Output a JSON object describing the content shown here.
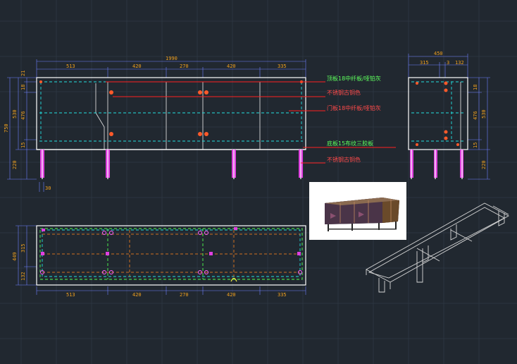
{
  "front_view": {
    "overall_width": "1990",
    "segments": [
      "513",
      "420",
      "270",
      "420",
      "335"
    ],
    "left_dims_outer": "750",
    "left_dims_mid": "530",
    "left_dims": [
      "21",
      "18",
      "476",
      "15",
      "220"
    ],
    "leg_offset": "30"
  },
  "side_view": {
    "overall_width": "450",
    "segments": [
      "315",
      "3",
      "132"
    ],
    "right_dims": [
      "18",
      "476",
      "15"
    ],
    "right_dims_outer": "530",
    "leg_height": "220"
  },
  "plan_view": {
    "segments": [
      "513",
      "420",
      "270",
      "420",
      "335"
    ],
    "left_dims_outer": "449",
    "left_dims": [
      "315",
      "132"
    ]
  },
  "annotations": {
    "top_panel": "顶板18中纤板/哑铂灰",
    "steel_antique_1": "不锈钢古铜色",
    "door_panel": "门板18中纤板/哑铂灰",
    "bottom_panel": "底板15布纹三胶板",
    "steel_antique_2": "不锈钢古铜色"
  },
  "colors": {
    "background": "#212830",
    "dimension_text": "#f0a01e",
    "annotation_text": "#ff4a4a",
    "annotation_highlight": "#5dff5d",
    "hidden_lines": "#22e0e0"
  }
}
